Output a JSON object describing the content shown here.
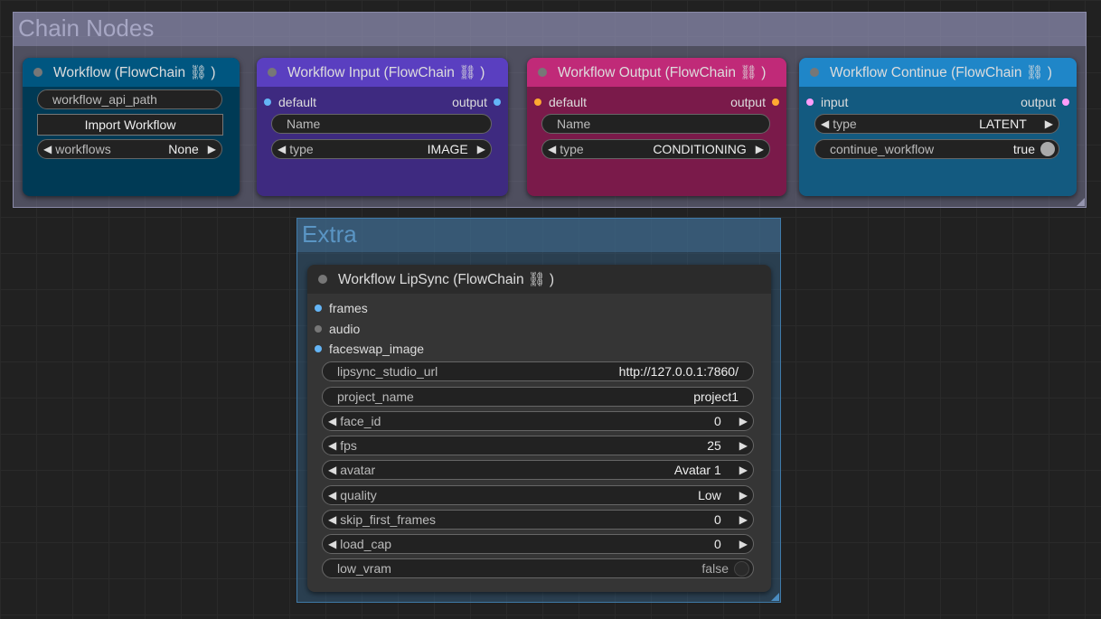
{
  "groups": {
    "chain": {
      "title": "Chain Nodes"
    },
    "extra": {
      "title": "Extra"
    }
  },
  "nodes": {
    "workflow": {
      "title": "Workflow (FlowChain ⛓ )",
      "api_path": "workflow_api_path",
      "import_button": "Import Workflow",
      "workflows": {
        "label": "workflows",
        "value": "None"
      }
    },
    "workflow_input": {
      "title": "Workflow Input (FlowChain ⛓ )",
      "input_label": "default",
      "output_label": "output",
      "name_placeholder": "Name",
      "type": {
        "label": "type",
        "value": "IMAGE"
      }
    },
    "workflow_output": {
      "title": "Workflow Output (FlowChain ⛓ )",
      "input_label": "default",
      "output_label": "output",
      "name_placeholder": "Name",
      "type": {
        "label": "type",
        "value": "CONDITIONING"
      }
    },
    "workflow_continue": {
      "title": "Workflow Continue (FlowChain ⛓ )",
      "input_label": "input",
      "output_label": "output",
      "type": {
        "label": "type",
        "value": "LATENT"
      },
      "continue_workflow": {
        "label": "continue_workflow",
        "value": "true"
      }
    },
    "lipsync": {
      "title": "Workflow LipSync (FlowChain ⛓ )",
      "inputs": [
        "frames",
        "audio",
        "faceswap_image"
      ],
      "lipsync_studio_url": {
        "label": "lipsync_studio_url",
        "value": "http://127.0.0.1:7860/"
      },
      "project_name": {
        "label": "project_name",
        "value": "project1"
      },
      "face_id": {
        "label": "face_id",
        "value": "0"
      },
      "fps": {
        "label": "fps",
        "value": "25"
      },
      "avatar": {
        "label": "avatar",
        "value": "Avatar 1"
      },
      "quality": {
        "label": "quality",
        "value": "Low"
      },
      "skip_first_frames": {
        "label": "skip_first_frames",
        "value": "0"
      },
      "load_cap": {
        "label": "load_cap",
        "value": "0"
      },
      "low_vram": {
        "label": "low_vram",
        "value": "false"
      }
    }
  },
  "icons": {
    "left_arrow": "◀",
    "right_arrow": "▶"
  },
  "colors": {
    "socket_image": "#64b5f6",
    "socket_conditioning": "#ffa931",
    "socket_latent": "#ff9cf9",
    "socket_audio": "#777777"
  }
}
